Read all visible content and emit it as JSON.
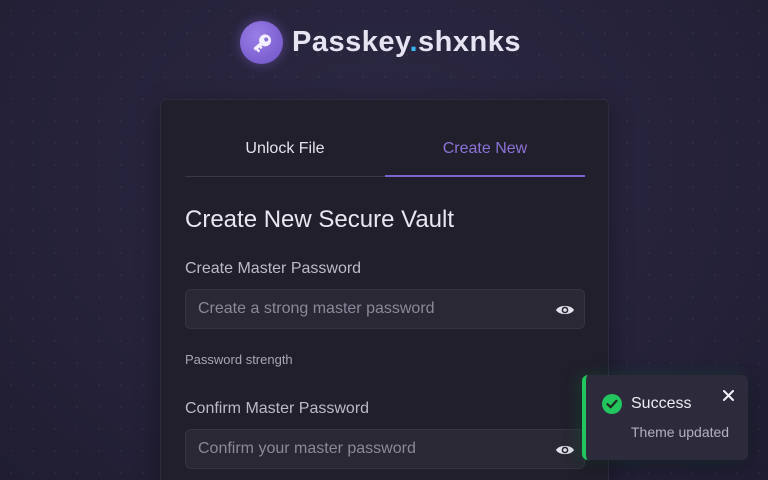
{
  "brand": {
    "name_part1": "Passkey",
    "dot": ".",
    "name_part2": "shxnks",
    "logo_icon": "key-icon",
    "accent_color": "#7c5fd0",
    "dot_color": "#39b6f0"
  },
  "tabs": [
    {
      "label": "Unlock File",
      "active": false
    },
    {
      "label": "Create New",
      "active": true
    }
  ],
  "create_form": {
    "title": "Create New Secure Vault",
    "master_password": {
      "label": "Create Master Password",
      "placeholder": "Create a strong master password",
      "value": "",
      "toggle_icon": "eye-icon"
    },
    "strength_label": "Password strength",
    "confirm_password": {
      "label": "Confirm Master Password",
      "placeholder": "Confirm your master password",
      "value": "",
      "toggle_icon": "eye-icon"
    }
  },
  "toast": {
    "title": "Success",
    "message": "Theme updated",
    "status_icon": "check-circle-icon",
    "close_icon": "close-icon",
    "status_color": "#22c55e"
  }
}
